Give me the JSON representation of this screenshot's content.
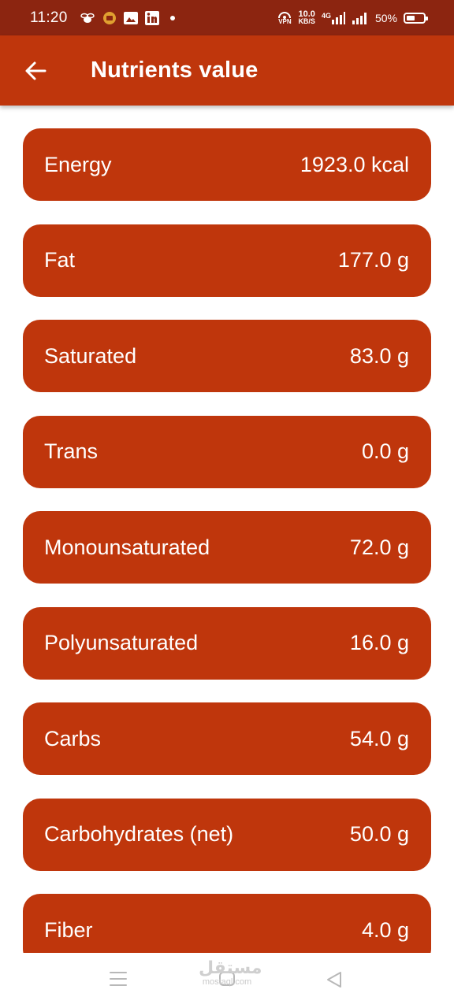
{
  "status_bar": {
    "time": "11:20",
    "vpn_label": "VPN",
    "net_speed_value": "10.0",
    "net_speed_unit": "KB/S",
    "network_type": "4G",
    "battery_percent_text": "50%",
    "battery_level": 0.5,
    "left_icons": [
      "bee-icon",
      "coin-icon",
      "photo-icon",
      "linkedin-icon",
      "notification-dot-icon"
    ]
  },
  "app_bar": {
    "title": "Nutrients value",
    "back_icon": "arrow-left-icon"
  },
  "nutrients": [
    {
      "name": "Energy",
      "value": "1923.0 kcal"
    },
    {
      "name": "Fat",
      "value": "177.0 g"
    },
    {
      "name": "Saturated",
      "value": "83.0 g"
    },
    {
      "name": "Trans",
      "value": "0.0 g"
    },
    {
      "name": "Monounsaturated",
      "value": "72.0 g"
    },
    {
      "name": "Polyunsaturated",
      "value": "16.0 g"
    },
    {
      "name": "Carbs",
      "value": "54.0 g"
    },
    {
      "name": "Carbohydrates (net)",
      "value": "50.0 g"
    },
    {
      "name": "Fiber",
      "value": "4.0 g"
    }
  ],
  "nav_bar": {
    "icons": [
      "menu-icon",
      "home-icon",
      "back-triangle-icon"
    ]
  },
  "watermark": {
    "arabic": "مستقل",
    "latin": "mostaql.com"
  },
  "colors": {
    "status_bar": "#8c2510",
    "primary": "#bf360c",
    "text_on_primary": "#ffffff",
    "background": "#ffffff"
  }
}
